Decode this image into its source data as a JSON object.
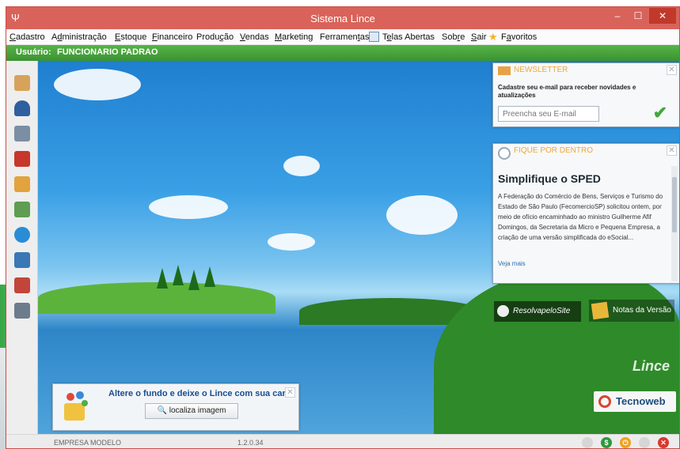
{
  "window": {
    "title": "Sistema Lince",
    "min_glyph": "–",
    "max_glyph": "☐",
    "close_glyph": "✕",
    "app_glyph": "Ψ"
  },
  "menu": [
    {
      "label": "Cadastro",
      "mnemonic": "C",
      "rest": "adastro"
    },
    {
      "label": "Administração",
      "pre": "A",
      "mnemonic": "d",
      "rest": "ministração"
    },
    {
      "label": "Estoque",
      "mnemonic": "E",
      "rest": "stoque"
    },
    {
      "label": "Financeiro",
      "mnemonic": "F",
      "rest": "inanceiro"
    },
    {
      "label": "Produção",
      "pre": "Produ",
      "mnemonic": "ç",
      "rest": "ão"
    },
    {
      "label": "Vendas",
      "mnemonic": "V",
      "rest": "endas"
    },
    {
      "label": "Marketing",
      "mnemonic": "M",
      "rest": "arketing"
    },
    {
      "label": "Ferramentas",
      "pre": "Ferramen",
      "mnemonic": "t",
      "rest": "as"
    },
    {
      "label": "Telas Abertas",
      "pre": "T",
      "mnemonic": "e",
      "rest": "las Abertas"
    },
    {
      "label": "Sobre",
      "pre": "Sob",
      "mnemonic": "r",
      "rest": "e"
    },
    {
      "label": "Sair",
      "mnemonic": "S",
      "rest": "air"
    },
    {
      "label": "Favoritos",
      "pre": "F",
      "mnemonic": "a",
      "rest": "voritos"
    }
  ],
  "user": {
    "label": "Usuário:",
    "name": "FUNCIONARIO PADRAO"
  },
  "toolbar_icons": [
    "box-icon",
    "user-stamp-icon",
    "truck-icon",
    "red-truck-icon",
    "package-icon",
    "money-icon",
    "sync-icon",
    "computer-icon",
    "tag-icon",
    "monitor-icon"
  ],
  "newsletter": {
    "title": "NEWSLETTER",
    "text": "Cadastre seu e-mail para receber novidades e atualizações",
    "placeholder": "Preencha seu E-mail",
    "ok_glyph": "✔",
    "close_glyph": "✕"
  },
  "fique": {
    "title": "FIQUE POR DENTRO",
    "headline": "Simplifique o SPED",
    "body": "A Federação do Comércio de Bens, Serviços e Turismo do Estado de São Paulo (FecomercioSP) solicitou ontem, por meio de ofício encaminhado ao ministro Guilherme Afif Domingos, da Secretaria da Micro e Pequena Empresa, a criação de uma versão simplificada do eSocial...",
    "more": "Veja mais",
    "close_glyph": "✕"
  },
  "links": {
    "resolva": "ResolvapeloSite",
    "notas": "Notas da Versão"
  },
  "brand": {
    "lince": "Lince",
    "tecno": "Tecnoweb"
  },
  "wallpaper": {
    "message": "Altere o fundo e deixe o Lince com sua cara",
    "button": "🔍 localiza imagem",
    "close_glyph": "✕"
  },
  "status": {
    "company": "EMPRESA MODELO",
    "version": "1.2.0.34"
  },
  "status_icons": [
    {
      "name": "status-gray-icon",
      "color": "#d6d6d6",
      "glyph": ""
    },
    {
      "name": "status-dollar-icon",
      "color": "#2c9a3b",
      "glyph": "$"
    },
    {
      "name": "status-power-icon",
      "color": "#f0a21e",
      "glyph": "⏻"
    },
    {
      "name": "status-gray2-icon",
      "color": "#d6d6d6",
      "glyph": ""
    },
    {
      "name": "status-close-icon",
      "color": "#d8382e",
      "glyph": "✕"
    }
  ],
  "colors": {
    "title": "#d9635a",
    "userbar": "#3f9a33",
    "accent": "#f0a73a"
  }
}
